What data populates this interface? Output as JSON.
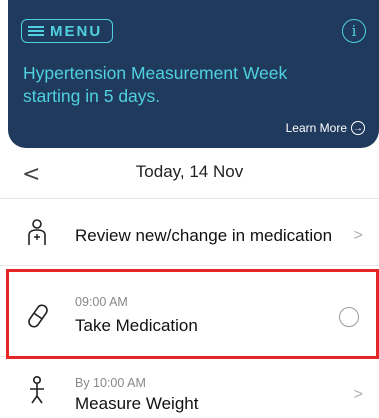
{
  "header": {
    "menu_label": "MENU",
    "info_icon": "info-icon",
    "banner_text": "Hypertension Measurement Week starting in 5 days.",
    "learn_more": "Learn More"
  },
  "date_bar": {
    "date": "Today, 14 Nov"
  },
  "tasks": [
    {
      "icon": "person-medication-icon",
      "time": "",
      "title": "Review new/change in medication"
    },
    {
      "icon": "pill-icon",
      "time": "09:00 AM",
      "title": "Take Medication",
      "status": "unchecked"
    },
    {
      "icon": "scale-person-icon",
      "time": "By 10:00 AM",
      "title": "Measure Weight"
    }
  ],
  "colors": {
    "header_bg": "#1f3a5c",
    "accent": "#4fd1e0",
    "highlight": "#e52626"
  }
}
